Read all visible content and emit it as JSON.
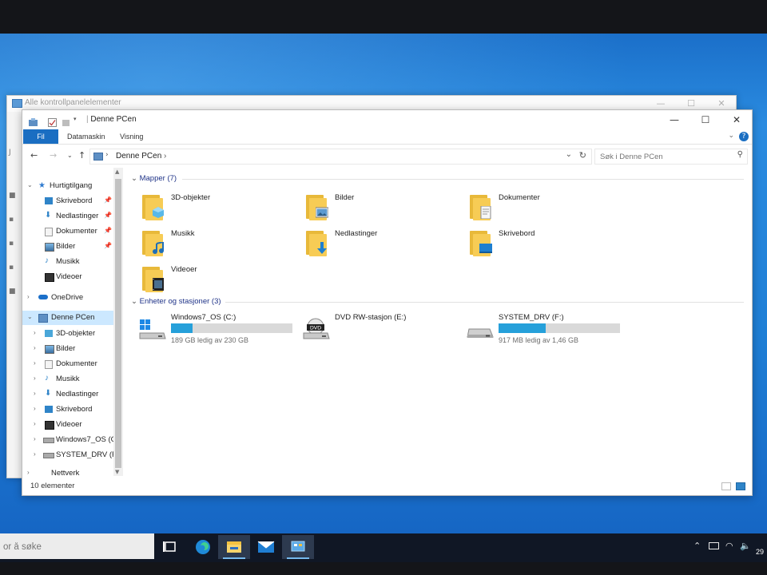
{
  "colors": {
    "accent": "#1a6ec2",
    "folder": "#f7cc55",
    "drive_bar": "#26a0da",
    "selection": "#cce8ff",
    "taskbar": "#101725"
  },
  "background_window": {
    "title": "Alle kontrollpanelelementer"
  },
  "window": {
    "title": "Denne PCen",
    "ribbon_tabs": [
      "Fil",
      "Datamaskin",
      "Visning"
    ],
    "address": {
      "crumb": "Denne PCen"
    },
    "search": {
      "placeholder": "Søk i Denne PCen"
    }
  },
  "nav_pane": {
    "quick_access": "Hurtigtilgang",
    "quick_items": [
      {
        "label": "Skrivebord",
        "icon": "desktop-icon"
      },
      {
        "label": "Nedlastinger",
        "icon": "download-icon"
      },
      {
        "label": "Dokumenter",
        "icon": "documents-icon"
      },
      {
        "label": "Bilder",
        "icon": "pictures-icon"
      },
      {
        "label": "Musikk",
        "icon": "music-icon"
      },
      {
        "label": "Videoer",
        "icon": "videos-icon"
      }
    ],
    "onedrive": "OneDrive",
    "this_pc": "Denne PCen",
    "pc_items": [
      "3D-objekter",
      "Bilder",
      "Dokumenter",
      "Musikk",
      "Nedlastinger",
      "Skrivebord",
      "Videoer",
      "Windows7_OS (C",
      "SYSTEM_DRV (F:"
    ],
    "network": "Nettverk"
  },
  "content": {
    "folders_header": "Mapper (7)",
    "folders": [
      {
        "label": "3D-objekter",
        "icon": "3d-objects-icon"
      },
      {
        "label": "Bilder",
        "icon": "pictures-icon"
      },
      {
        "label": "Dokumenter",
        "icon": "documents-icon"
      },
      {
        "label": "Musikk",
        "icon": "music-icon"
      },
      {
        "label": "Nedlastinger",
        "icon": "download-icon"
      },
      {
        "label": "Skrivebord",
        "icon": "desktop-icon"
      },
      {
        "label": "Videoer",
        "icon": "videos-icon"
      }
    ],
    "devices_header": "Enheter og stasjoner (3)",
    "drives": [
      {
        "label": "Windows7_OS (C:)",
        "free": "189 GB ledig av 230 GB",
        "used_fraction": 0.18,
        "icon": "windows-drive-icon"
      },
      {
        "label": "DVD RW-stasjon (E:)",
        "icon": "dvd-drive-icon"
      },
      {
        "label": "SYSTEM_DRV (F:)",
        "free": "917 MB ledig av 1,46 GB",
        "used_fraction": 0.39,
        "icon": "drive-icon"
      }
    ]
  },
  "status": {
    "count": "10 elementer"
  },
  "taskbar": {
    "search_placeholder": "or å søke",
    "clock": "29"
  }
}
